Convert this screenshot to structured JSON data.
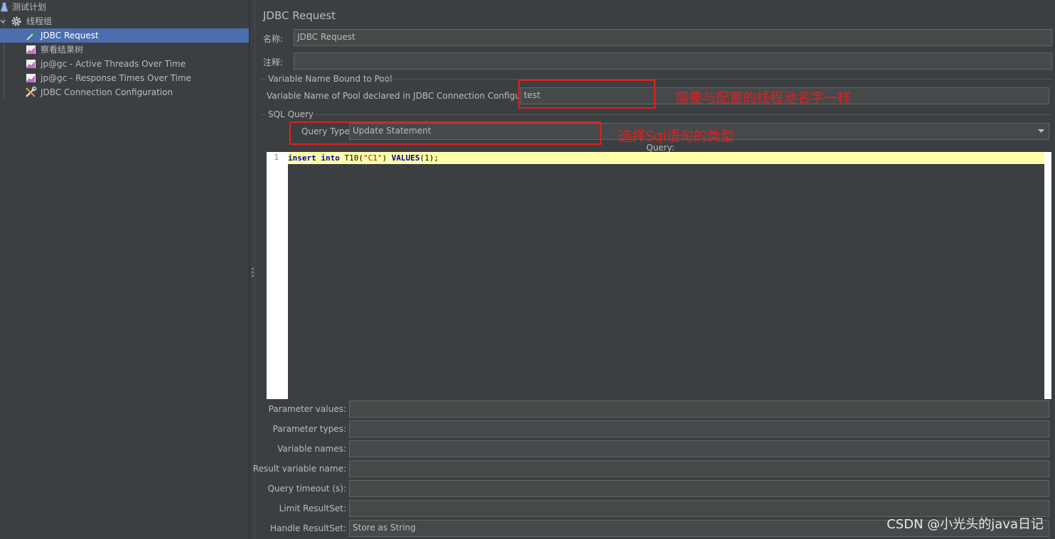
{
  "tree": {
    "items": [
      {
        "label": "测试计划",
        "icon": "test-plan-icon"
      },
      {
        "label": "线程组",
        "icon": "gear-icon"
      },
      {
        "label": "JDBC Request",
        "icon": "pipette-icon"
      },
      {
        "label": "察看结果树",
        "icon": "graph-icon"
      },
      {
        "label": "jp@gc - Active Threads Over Time",
        "icon": "graph-icon"
      },
      {
        "label": "jp@gc - Response Times Over Time",
        "icon": "graph-icon"
      },
      {
        "label": "JDBC Connection Configuration",
        "icon": "wrench-icon"
      }
    ],
    "selected": "JDBC Request"
  },
  "panel": {
    "title": "JDBC Request",
    "name_label": "名称:",
    "name_value": "JDBC Request",
    "comments_label": "注释:",
    "comments_value": "",
    "pool_section": "Variable Name Bound to Pool",
    "pool_label": "Variable Name of Pool declared in JDBC Connection Configuration:",
    "pool_value": "test",
    "sql_section": "SQL Query",
    "query_type_label": "Query Type:",
    "query_type_value": "Update Statement",
    "query_label": "Query:",
    "code": {
      "line_number": "1",
      "kw1": "insert",
      "kw2": "into",
      "table": "T10(",
      "string": "\"C1\"",
      "close": ")",
      "kw3": "VALUES",
      "tail": "(1);"
    },
    "params": [
      {
        "label": "Parameter values:",
        "value": ""
      },
      {
        "label": "Parameter types:",
        "value": ""
      },
      {
        "label": "Variable names:",
        "value": ""
      },
      {
        "label": "Result variable name:",
        "value": ""
      },
      {
        "label": "Query timeout (s):",
        "value": ""
      },
      {
        "label": "Limit ResultSet:",
        "value": ""
      },
      {
        "label": "Handle ResultSet:",
        "value": "Store as String"
      }
    ]
  },
  "annotations": {
    "pool_note": "需要与配置的线程池名字一样",
    "type_note": "选择Sql语句的类型",
    "color": "#e02020"
  },
  "watermark": "CSDN @小光头的java日记",
  "colors": {
    "background": "#3c3f41",
    "selection": "#4b6eaf",
    "field": "#45494a"
  }
}
